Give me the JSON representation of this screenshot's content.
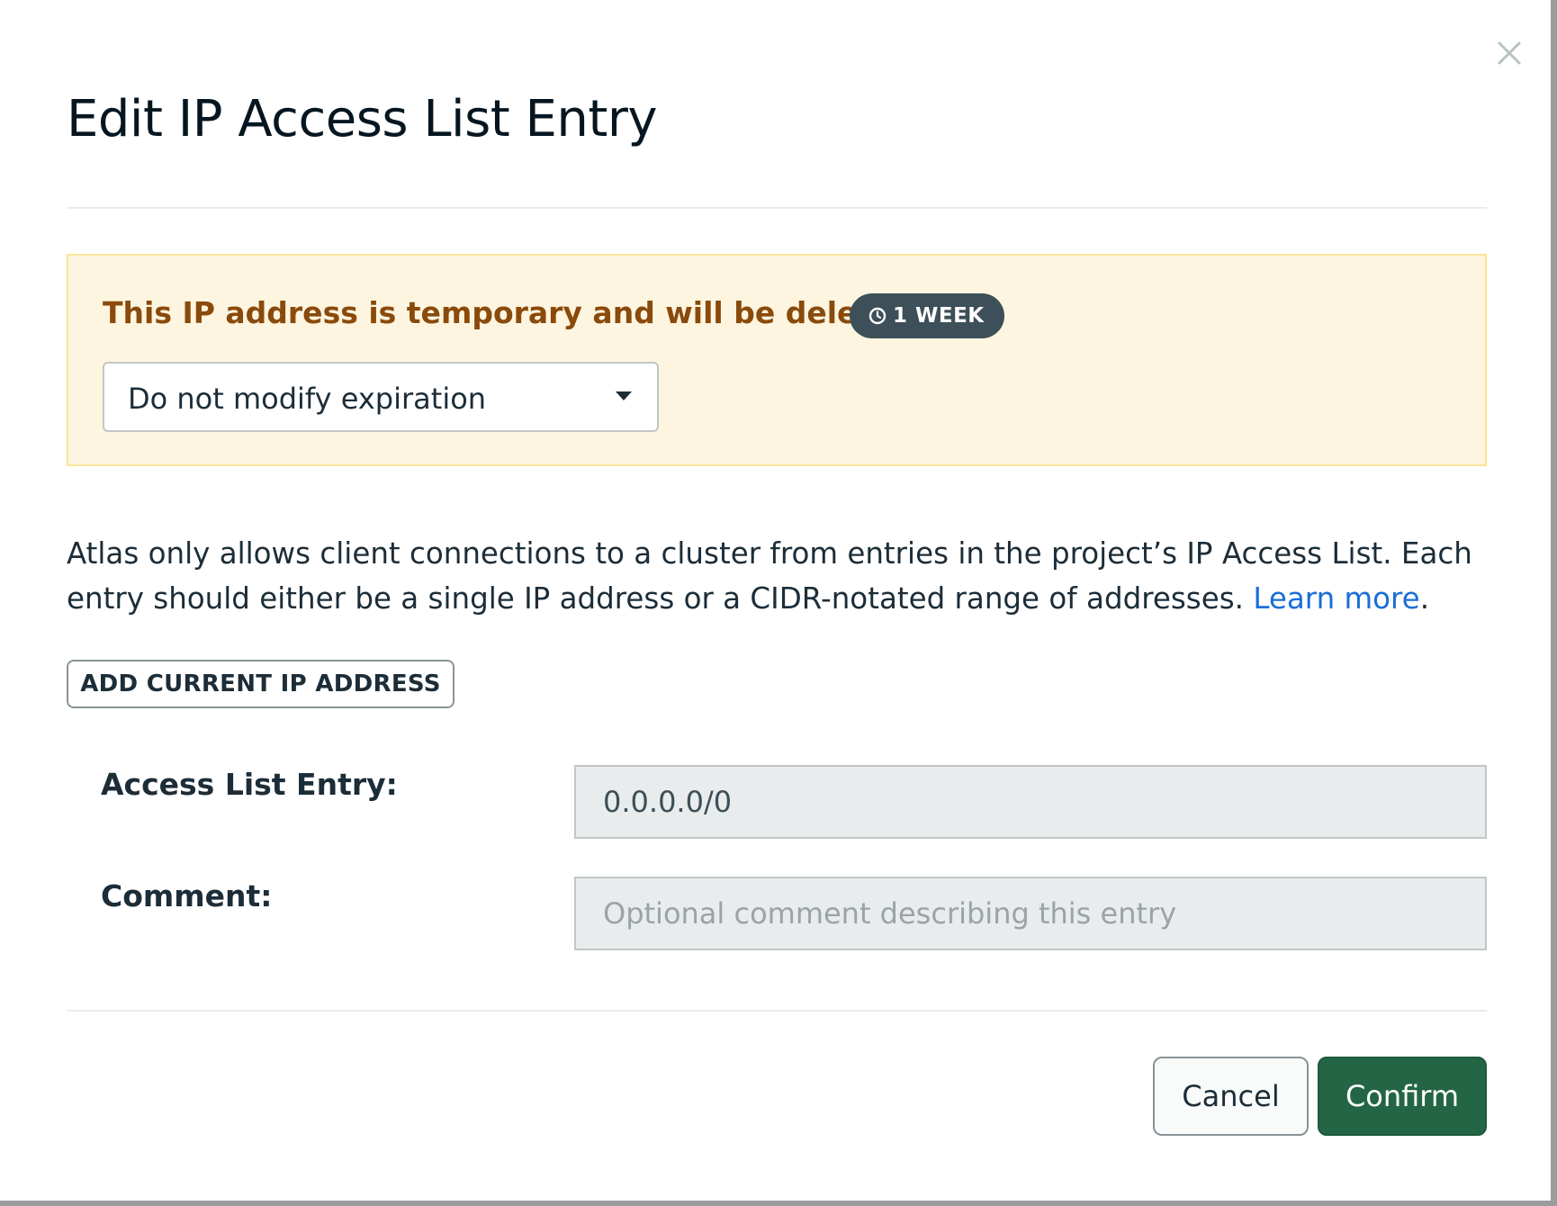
{
  "dialog": {
    "title": "Edit IP Access List Entry",
    "close_icon": "close-icon"
  },
  "banner": {
    "message": "This IP address is temporary and will be deleted in",
    "badge_icon": "clock-icon",
    "badge_label": "1 WEEK",
    "select_value": "Do not modify expiration",
    "select_icon": "caret-down-icon"
  },
  "description": {
    "text": "Atlas only allows client connections to a cluster from entries in the project’s IP Access List. Each entry should either be a single IP address or a CIDR-notated range of addresses.",
    "link_text": "Learn more",
    "trailing": "."
  },
  "add_ip_button": "ADD CURRENT IP ADDRESS",
  "form": {
    "entry_label": "Access List Entry:",
    "entry_value": "0.0.0.0/0",
    "comment_label": "Comment:",
    "comment_value": "",
    "comment_placeholder": "Optional comment describing this entry"
  },
  "footer": {
    "cancel_label": "Cancel",
    "confirm_label": "Confirm"
  },
  "colors": {
    "banner_background": "#fdf5df",
    "banner_text": "#8a4a0b",
    "badge_background": "#3d4f58",
    "link": "#1a6fd8",
    "confirm_background": "#246546"
  }
}
